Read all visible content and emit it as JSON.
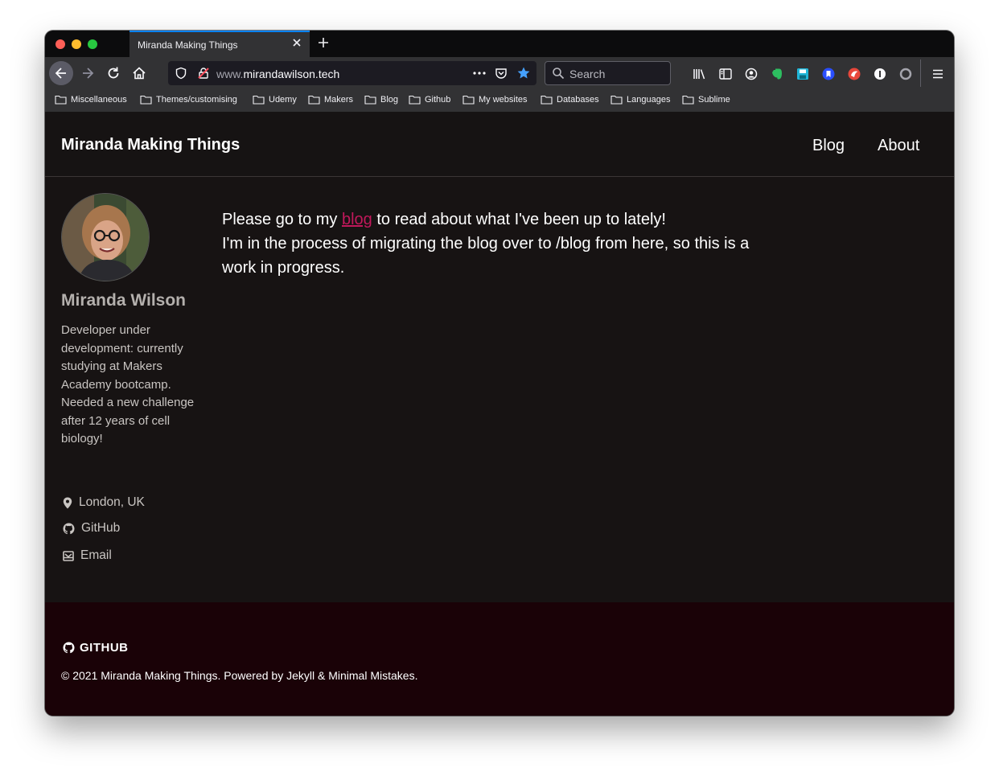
{
  "browser": {
    "tab_title": "Miranda Making Things",
    "url_prefix": "www.",
    "url_domain": "mirandawilson.tech",
    "search_placeholder": "Search",
    "accent_color": "#0a84ff"
  },
  "bookmarks": [
    "Miscellaneous",
    "Themes/customising",
    "Udemy",
    "Makers",
    "Blog",
    "Github",
    "My websites",
    "Databases",
    "Languages",
    "Sublime"
  ],
  "site": {
    "title": "Miranda Making Things",
    "nav": [
      "Blog",
      "About"
    ]
  },
  "author": {
    "name": "Miranda Wilson",
    "bio": "Developer under development: currently studying at Makers Academy bootcamp. Needed a new challenge after 12 years of cell biology!",
    "location": "London, UK",
    "github": "GitHub",
    "email": "Email"
  },
  "content": {
    "line1_before": "Please go to my ",
    "line1_link": "blog",
    "line1_after": " to read about what I've been up to lately!",
    "line2": "I'm in the process of migrating the blog over to /blog from here, so this is a work in progress.",
    "link_color": "#c2185b"
  },
  "footer": {
    "follow_label": "GITHUB",
    "copyright": "© 2021 Miranda Making Things. Powered by Jekyll & Minimal Mistakes."
  }
}
